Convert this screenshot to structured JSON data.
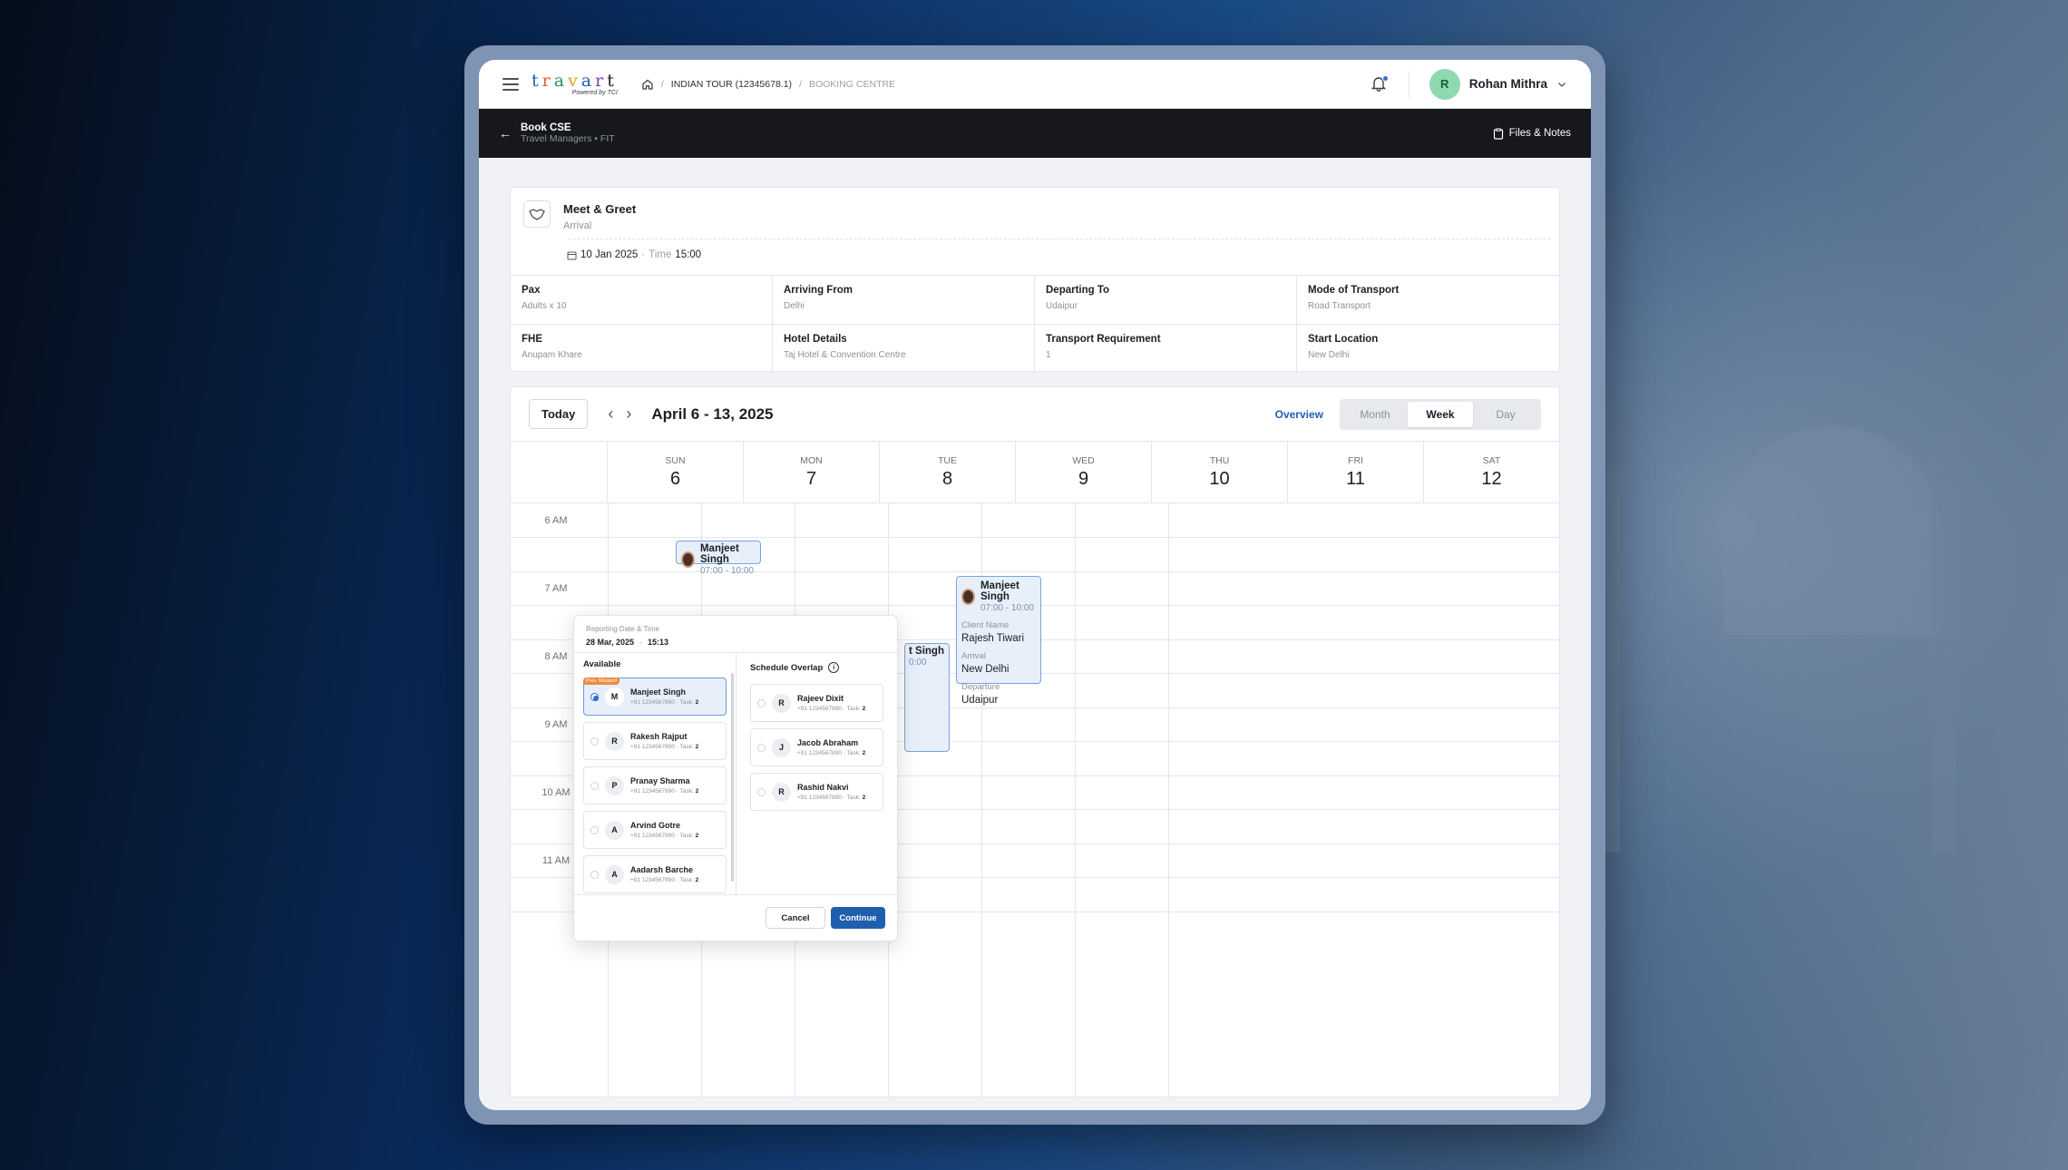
{
  "header": {
    "brand": "travart",
    "brand_sub": "Powered by TCI",
    "crumb_tour": "INDIAN TOUR (12345678.1)",
    "crumb_section": "BOOKING CENTRE",
    "user_initial": "R",
    "user_name": "Rohan Mithra"
  },
  "subbar": {
    "title": "Book CSE",
    "meta": "Travel Managers • FIT",
    "files_label": "Files & Notes"
  },
  "service": {
    "name": "Meet & Greet",
    "type": "Arrival",
    "date": "10 Jan 2025",
    "time_label": "Time",
    "time": "15:00"
  },
  "details": [
    {
      "label": "Pax",
      "value": "Adults x 10"
    },
    {
      "label": "Arriving From",
      "value": "Delhi"
    },
    {
      "label": "Departing To",
      "value": "Udaipur"
    },
    {
      "label": "Mode of Transport",
      "value": "Road Transport"
    },
    {
      "label": "FHE",
      "value": "Anupam Khare"
    },
    {
      "label": "Hotel Details",
      "value": "Taj Hotel & Convention Centre"
    },
    {
      "label": "Transport Requirement",
      "value": "1"
    },
    {
      "label": "Start Location",
      "value": "New Delhi"
    }
  ],
  "calendar": {
    "today_label": "Today",
    "range": "April 6 - 13, 2025",
    "overview_label": "Overview",
    "views": [
      "Month",
      "Week",
      "Day"
    ],
    "active_view": "Week",
    "days": [
      {
        "name": "SUN",
        "num": "6"
      },
      {
        "name": "MON",
        "num": "7"
      },
      {
        "name": "TUE",
        "num": "8"
      },
      {
        "name": "WED",
        "num": "9"
      },
      {
        "name": "THU",
        "num": "10"
      },
      {
        "name": "FRI",
        "num": "11"
      },
      {
        "name": "SAT",
        "num": "12"
      }
    ],
    "times": [
      "6 AM",
      "7 AM",
      "8 AM",
      "9 AM",
      "10 AM",
      "11 AM"
    ],
    "events": {
      "mon": {
        "name": "Manjeet Singh",
        "time": "07:00 - 10:00"
      },
      "wed": {
        "name": "t Singh",
        "time": "0:00"
      },
      "thu": {
        "name": "Manjeet Singh",
        "time": "07:00 - 10:00",
        "client_label": "Client Name",
        "client": "Rajesh Tiwari",
        "arrival_label": "Arrival",
        "arrival": "New Delhi",
        "departure_label": "Departure",
        "departure": "Udaipur"
      }
    }
  },
  "popup": {
    "reporting_label": "Reporting Date & Time",
    "reporting_date": "28 Mar, 2025",
    "reporting_time": "15:13",
    "available_title": "Available",
    "overlap_title": "Schedule Overlap",
    "prev_tag": "Prev. Mapped",
    "task_label": "Task:",
    "available": [
      {
        "initial": "M",
        "name": "Manjeet Singh",
        "phone": "+91 1234567890",
        "tasks": "2"
      },
      {
        "initial": "R",
        "name": "Rakesh Rajput",
        "phone": "+91 1234567890",
        "tasks": "2"
      },
      {
        "initial": "P",
        "name": "Pranay Sharma",
        "phone": "+91 1234567890",
        "tasks": "2"
      },
      {
        "initial": "A",
        "name": "Arvind Gotre",
        "phone": "+91 1234567890",
        "tasks": "2"
      },
      {
        "initial": "A",
        "name": "Aadarsh Barche",
        "phone": "+91 1234567890",
        "tasks": "2"
      }
    ],
    "overlap": [
      {
        "initial": "R",
        "name": "Rajeev Dixit",
        "phone": "+91 1234567890",
        "tasks": "2"
      },
      {
        "initial": "J",
        "name": "Jacob Abraham",
        "phone": "+91 1234567890",
        "tasks": "2"
      },
      {
        "initial": "R",
        "name": "Rashid Nakvi",
        "phone": "+91 1234567890",
        "tasks": "2"
      }
    ],
    "cancel_label": "Cancel",
    "continue_label": "Continue"
  }
}
